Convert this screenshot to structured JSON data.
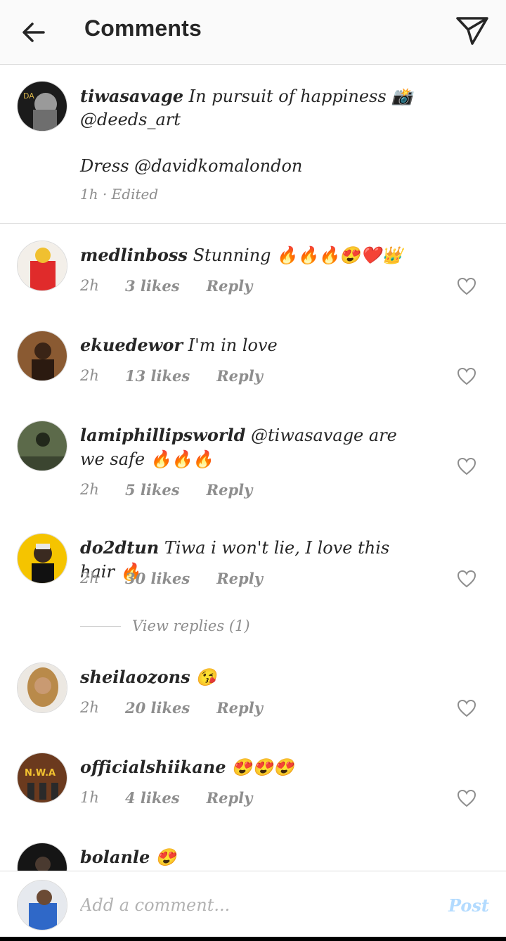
{
  "header": {
    "title": "Comments"
  },
  "caption": {
    "username": "tiwasavage",
    "text": "In pursuit of happiness 📸 @deeds_art",
    "line2": "Dress @davidkomalondon",
    "meta": "1h · Edited"
  },
  "comments": [
    {
      "username": "medlinboss",
      "text": "Stunning 🔥🔥🔥😍❤️👑",
      "time": "2h",
      "likes": "3 likes",
      "reply": "Reply"
    },
    {
      "username": "ekuedewor",
      "text": "I'm in love",
      "time": "2h",
      "likes": "13 likes",
      "reply": "Reply"
    },
    {
      "username": "lamiphillipsworld",
      "text": "@tiwasavage are we safe 🔥🔥🔥",
      "time": "2h",
      "likes": "5 likes",
      "reply": "Reply"
    },
    {
      "username": "do2dtun",
      "text": "Tiwa i won't lie, I love this hair 🔥",
      "time": "2h",
      "likes": "30 likes",
      "reply": "Reply"
    },
    {
      "username": "sheilaozons",
      "text": "😘",
      "time": "2h",
      "likes": "20 likes",
      "reply": "Reply"
    },
    {
      "username": "officialshiikane",
      "text": "😍😍😍",
      "time": "1h",
      "likes": "4 likes",
      "reply": "Reply"
    },
    {
      "username": "bolanle",
      "text": "😍",
      "time": "",
      "likes": "",
      "reply": ""
    }
  ],
  "view_replies": "View replies (1)",
  "composer": {
    "placeholder": "Add a comment...",
    "post_label": "Post"
  },
  "colors": {
    "text": "#262626",
    "secondary": "#8e8e8e",
    "post_disabled": "#b3dbff",
    "divider": "#dbdbdb"
  }
}
